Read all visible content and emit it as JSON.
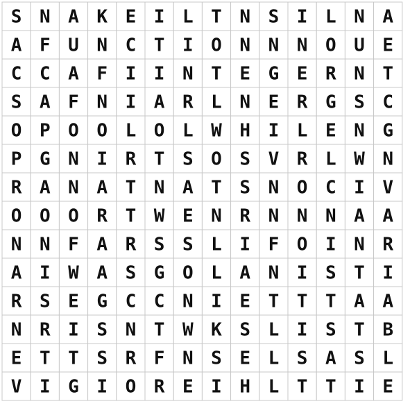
{
  "puzzle": {
    "rows": [
      [
        "S",
        "N",
        "A",
        "K",
        "E",
        "I",
        "L",
        "T",
        "N",
        "S",
        "I",
        "L",
        "N",
        "A"
      ],
      [
        "A",
        "F",
        "U",
        "N",
        "C",
        "T",
        "I",
        "O",
        "N",
        "N",
        "N",
        "O",
        "U",
        "E"
      ],
      [
        "C",
        "C",
        "A",
        "F",
        "I",
        "I",
        "N",
        "T",
        "E",
        "G",
        "E",
        "R",
        "N",
        "T"
      ],
      [
        "S",
        "A",
        "F",
        "N",
        "I",
        "A",
        "R",
        "L",
        "N",
        "E",
        "R",
        "G",
        "S",
        "C"
      ],
      [
        "O",
        "P",
        "O",
        "O",
        "L",
        "O",
        "L",
        "W",
        "H",
        "I",
        "L",
        "E",
        "N",
        "G"
      ],
      [
        "P",
        "G",
        "N",
        "I",
        "R",
        "T",
        "S",
        "O",
        "S",
        "V",
        "R",
        "L",
        "W",
        "N"
      ],
      [
        "R",
        "A",
        "N",
        "A",
        "T",
        "N",
        "A",
        "T",
        "S",
        "N",
        "O",
        "C",
        "I",
        "V"
      ],
      [
        "O",
        "O",
        "O",
        "R",
        "T",
        "W",
        "E",
        "N",
        "R",
        "N",
        "N",
        "N",
        "A",
        "A"
      ],
      [
        "N",
        "N",
        "F",
        "A",
        "R",
        "S",
        "S",
        "L",
        "I",
        "F",
        "O",
        "I",
        "N",
        "R"
      ],
      [
        "A",
        "I",
        "W",
        "A",
        "S",
        "G",
        "O",
        "L",
        "A",
        "N",
        "I",
        "S",
        "T",
        "I"
      ],
      [
        "R",
        "S",
        "E",
        "G",
        "C",
        "C",
        "N",
        "I",
        "E",
        "T",
        "T",
        "T",
        "A",
        "A"
      ],
      [
        "N",
        "R",
        "I",
        "S",
        "N",
        "T",
        "W",
        "K",
        "S",
        "L",
        "I",
        "S",
        "T",
        "B"
      ],
      [
        "E",
        "T",
        "T",
        "S",
        "R",
        "F",
        "N",
        "S",
        "E",
        "L",
        "S",
        "A",
        "S",
        "L"
      ],
      [
        "V",
        "I",
        "G",
        "I",
        "O",
        "R",
        "E",
        "I",
        "H",
        "L",
        "T",
        "T",
        "I",
        "E"
      ]
    ]
  }
}
